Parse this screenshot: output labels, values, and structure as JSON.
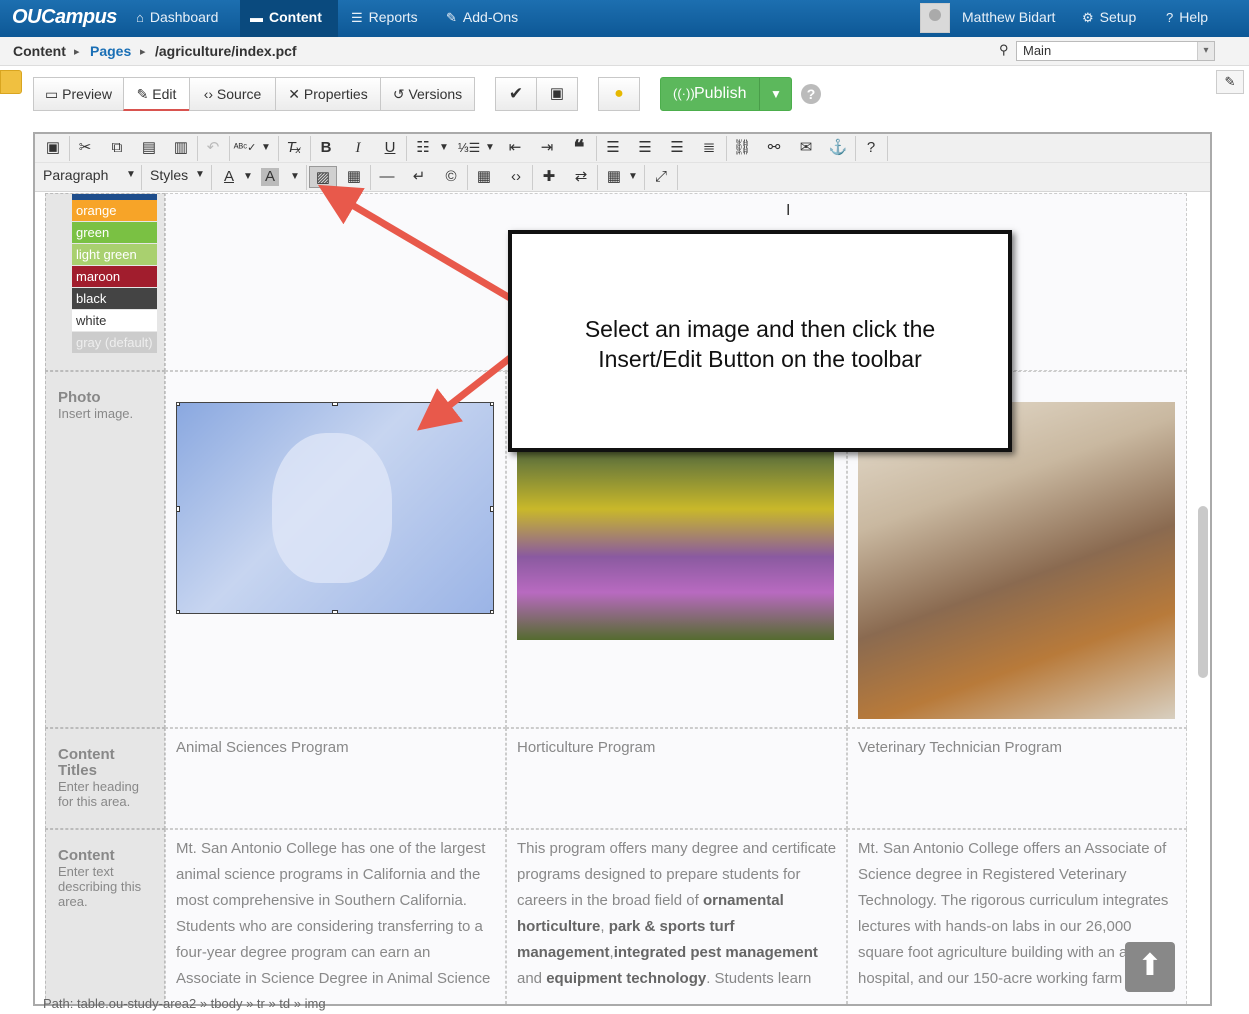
{
  "app": {
    "logo": "OUCampus"
  },
  "nav": {
    "dashboard": "Dashboard",
    "content": "Content",
    "reports": "Reports",
    "addons": "Add-Ons",
    "user": "Matthew Bidart",
    "setup": "Setup",
    "help": "Help"
  },
  "breadcrumb": {
    "root": "Content",
    "pages": "Pages",
    "path": "/agriculture/index.pcf",
    "sep": "▸"
  },
  "site_select": {
    "value": "Main"
  },
  "toolbar": {
    "preview": "Preview",
    "edit": "Edit",
    "source": "Source",
    "properties": "Properties",
    "versions": "Versions",
    "publish": "Publish"
  },
  "editor": {
    "format": "Paragraph",
    "styles": "Styles"
  },
  "swatches": [
    {
      "label": "orange",
      "color": "#f7a428"
    },
    {
      "label": "green",
      "color": "#7ac143"
    },
    {
      "label": "light green",
      "color": "#a9d06f"
    },
    {
      "label": "maroon",
      "color": "#a11d2d"
    },
    {
      "label": "black",
      "color": "#444444"
    },
    {
      "label": "white",
      "color": "#ffffff"
    },
    {
      "label": "gray (default)",
      "color": "#cccccc"
    }
  ],
  "rows": {
    "photo": {
      "title": "Photo",
      "hint": "Insert image."
    },
    "content_titles": {
      "title": "Content Titles",
      "hint": "Enter heading for this area."
    },
    "content": {
      "title": "Content",
      "hint": "Enter text describing this area."
    }
  },
  "columns": [
    {
      "title": "Animal Sciences Program",
      "text": "Mt. San Antonio College has one of the largest animal science programs in California and the most comprehensive in Southern California. Students who are considering transferring to a four-year degree program can earn an Associate in Science Degree in Animal Science"
    },
    {
      "title": "Horticulture Program",
      "text_a": "This program offers many degree and certificate programs designed to prepare students for careers in the broad field of ",
      "bold1": "ornamental horticulture",
      "sep1": ", ",
      "bold2": "park & sports turf management",
      "sep2": ",",
      "bold3": "integrated pest management",
      "text_b": " and ",
      "bold4": "equipment technology",
      "text_c": ". Students learn"
    },
    {
      "title": "Veterinary Technician Program",
      "text": "Mt. San Antonio College offers an Associate of Science degree in Registered Veterinary Technology. The rigorous curriculum integrates lectures with hands-on labs in our 26,000 square foot agriculture building with an animal hospital, and our 150-acre working farm"
    }
  ],
  "callout": {
    "line1": "Select an image and then click the",
    "line2": "Insert/Edit Button on the toolbar"
  },
  "status": {
    "path": "Path: table.ou-study-area2 » tbody » tr » td » img"
  }
}
